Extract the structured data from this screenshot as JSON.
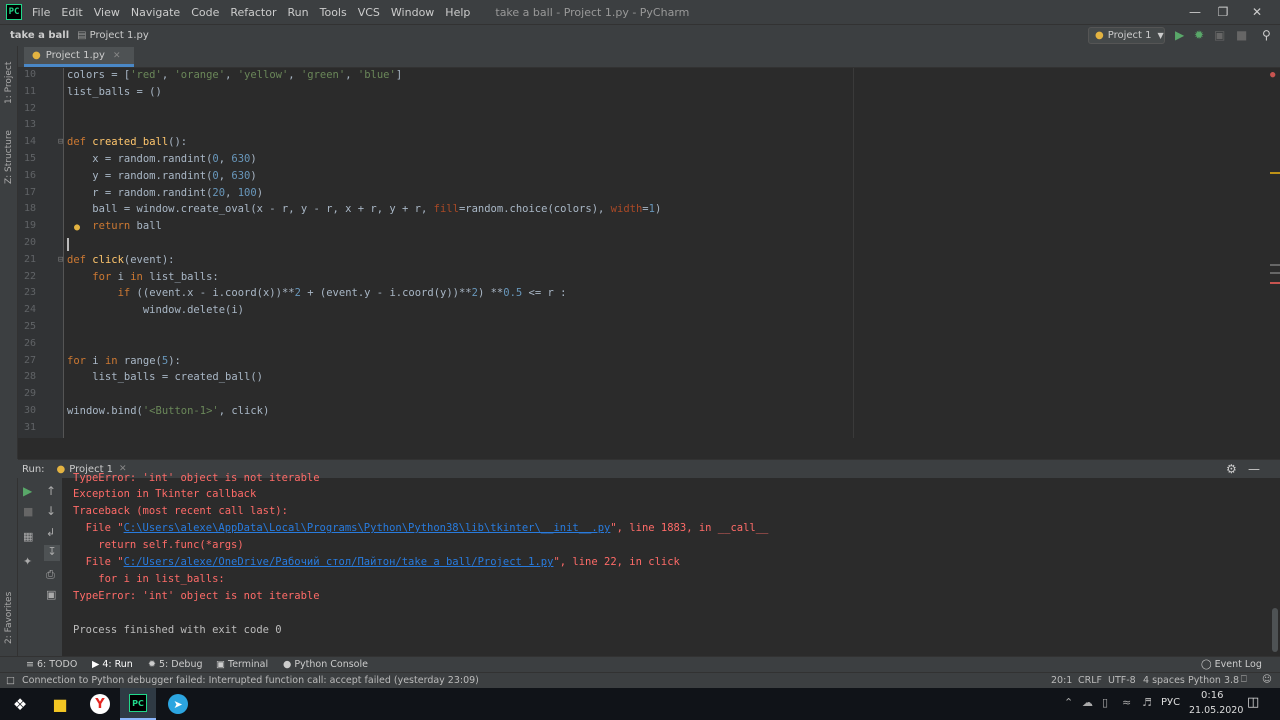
{
  "window": {
    "title": "take a ball - Project 1.py - PyCharm",
    "menus": [
      "File",
      "Edit",
      "View",
      "Navigate",
      "Code",
      "Refactor",
      "Run",
      "Tools",
      "VCS",
      "Window",
      "Help"
    ]
  },
  "nav": {
    "project": "take a ball",
    "file": "Project 1.py",
    "run_config": "Project 1"
  },
  "side_tabs": {
    "project": "1: Project",
    "structure": "Z: Structure",
    "favorites": "2: Favorites"
  },
  "editor": {
    "tab": "Project 1.py",
    "lines": [
      {
        "n": "10",
        "code": "colors = ['red', 'orange', 'yellow', 'green', 'blue']"
      },
      {
        "n": "11",
        "code": "list_balls = ()"
      },
      {
        "n": "12",
        "code": ""
      },
      {
        "n": "13",
        "code": ""
      },
      {
        "n": "14",
        "code": "def created_ball():"
      },
      {
        "n": "15",
        "code": "    x = random.randint(0, 630)"
      },
      {
        "n": "16",
        "code": "    y = random.randint(0, 630)"
      },
      {
        "n": "17",
        "code": "    r = random.randint(20, 100)"
      },
      {
        "n": "18",
        "code": "    ball = window.create_oval(x - r, y - r, x + r, y + r, fill=random.choice(colors), width=1)"
      },
      {
        "n": "19",
        "code": "    return ball"
      },
      {
        "n": "20",
        "code": ""
      },
      {
        "n": "21",
        "code": "def click(event):"
      },
      {
        "n": "22",
        "code": "    for i in list_balls:"
      },
      {
        "n": "23",
        "code": "        if ((event.x - i.coord(x))**2 + (event.y - i.coord(y))**2) **0.5 <= r :"
      },
      {
        "n": "24",
        "code": "            window.delete(i)"
      },
      {
        "n": "25",
        "code": ""
      },
      {
        "n": "26",
        "code": ""
      },
      {
        "n": "27",
        "code": "for i in range(5):"
      },
      {
        "n": "28",
        "code": "    list_balls = created_ball()"
      },
      {
        "n": "29",
        "code": ""
      },
      {
        "n": "30",
        "code": "window.bind('<Button-1>', click)"
      },
      {
        "n": "31",
        "code": ""
      }
    ]
  },
  "run": {
    "label": "Run:",
    "tab": "Project 1",
    "output": [
      "TypeError: 'int' object is not iterable",
      "Exception in Tkinter callback",
      "Traceback (most recent call last):",
      "  File \"C:\\Users\\alexe\\AppData\\Local\\Programs\\Python\\Python38\\lib\\tkinter\\__init__.py\", line 1883, in __call__",
      "    return self.func(*args)",
      "  File \"C:/Users/alexe/OneDrive/Рабочий стол/Пайтон/take a ball/Project 1.py\", line 22, in click",
      "    for i in list_balls:",
      "TypeError: 'int' object is not iterable",
      "",
      "Process finished with exit code 0"
    ]
  },
  "bottom_tabs": {
    "todo": "6: TODO",
    "run": "4: Run",
    "debug": "5: Debug",
    "terminal": "Terminal",
    "console": "Python Console",
    "event_log": "Event Log"
  },
  "status": {
    "message": "Connection to Python debugger failed: Interrupted function call: accept failed (yesterday 23:09)",
    "position": "20:1",
    "line_sep": "CRLF",
    "encoding": "UTF-8",
    "indent": "4 spaces",
    "interpreter": "Python 3.8"
  },
  "taskbar": {
    "lang": "РУС",
    "time": "0:16",
    "date": "21.05.2020"
  }
}
